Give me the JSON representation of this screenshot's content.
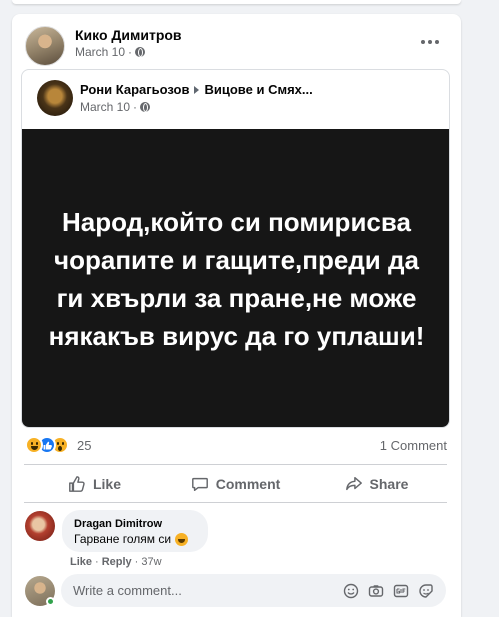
{
  "post": {
    "author": "Кико Димитров",
    "date": "March 10",
    "separator": "·",
    "shared": {
      "author": "Рони Карагьозов",
      "group": "Вицове и Смях...",
      "date": "March 10",
      "image_text": "Народ,който си помирисва чорапите и гащите,преди да ги хвърли за пране,не може някакъв вирус да го уплаши!"
    },
    "reactions": {
      "icons": [
        "haha-icon",
        "like-icon",
        "wow-icon"
      ],
      "count": "25"
    },
    "comment_count": "1 Comment",
    "actions": {
      "like": "Like",
      "comment": "Comment",
      "share": "Share"
    },
    "comment": {
      "name": "Dragan Dimitrow",
      "text": "Гарване голям си",
      "like": "Like",
      "dot": "·",
      "reply": "Reply",
      "time": "37w"
    },
    "write_placeholder": "Write a comment..."
  },
  "colors": {
    "background": "#f0f2f5",
    "card": "#ffffff",
    "secondary_text": "#65676b",
    "like_blue": "#1877f2",
    "reaction_yellow": "#f7b125",
    "online_green": "#31a24c",
    "image_bg": "#161616"
  }
}
